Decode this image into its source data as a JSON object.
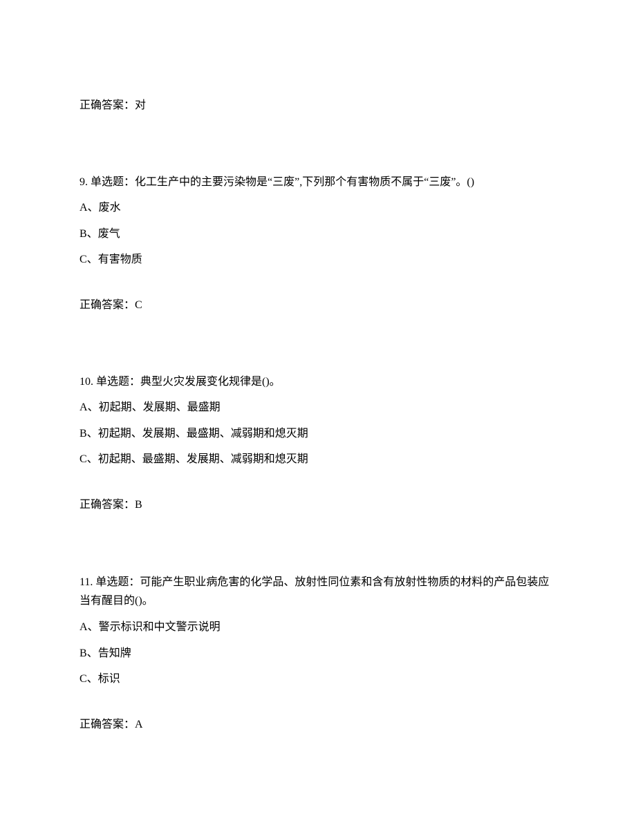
{
  "prev_answer": {
    "label": "正确答案：对"
  },
  "questions": [
    {
      "number": "9.",
      "type": "单选题：",
      "text": "化工生产中的主要污染物是“三废”,下列那个有害物质不属于“三废”。()",
      "options": [
        {
          "label": "A、",
          "text": "废水"
        },
        {
          "label": "B、",
          "text": "废气"
        },
        {
          "label": "C、",
          "text": "有害物质"
        }
      ],
      "answer_label": "正确答案：",
      "answer_value": "C"
    },
    {
      "number": "10.",
      "type": "单选题：",
      "text": "典型火灾发展变化规律是()。",
      "options": [
        {
          "label": "A、",
          "text": "初起期、发展期、最盛期"
        },
        {
          "label": "B、",
          "text": "初起期、发展期、最盛期、减弱期和熄灭期"
        },
        {
          "label": "C、",
          "text": "初起期、最盛期、发展期、减弱期和熄灭期"
        }
      ],
      "answer_label": "正确答案：",
      "answer_value": "B"
    },
    {
      "number": "11.",
      "type": "单选题：",
      "text": "可能产生职业病危害的化学品、放射性同位素和含有放射性物质的材料的产品包装应当有醒目的()。",
      "options": [
        {
          "label": "A、",
          "text": "警示标识和中文警示说明"
        },
        {
          "label": "B、",
          "text": "告知牌"
        },
        {
          "label": "C、",
          "text": "标识"
        }
      ],
      "answer_label": "正确答案：",
      "answer_value": "A"
    }
  ]
}
